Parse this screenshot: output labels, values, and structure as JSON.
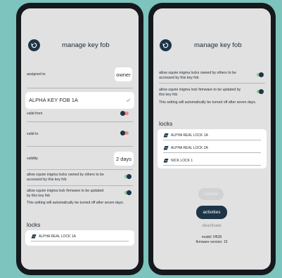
{
  "left": {
    "title": "manage key fob",
    "assigned_label": "assigned to",
    "assigned_value": "owner",
    "fob_name": "ALPHA KEY FOB 1A",
    "valid_from_label": "valid from",
    "valid_to_label": "valid to",
    "validity_label": "validity",
    "validity_value": "2 days",
    "opt1": "allow squire inigma locks owned by others to be accessed by this key fob",
    "opt2": "allow squire inigma lock firmware to be updated by this key fob",
    "note": "This setting will automatically be turned off after seven days.",
    "locks_title": "locks",
    "locks": [
      "ALPHA REAL LOCK 1A"
    ]
  },
  "right": {
    "title": "manage key fob",
    "opt1": "allow squire inigma locks owned by others to be accessed by this key fob",
    "opt2": "allow squire inigma lock firmware to be updated by this key fob",
    "note": "This setting will automatically be turned off after seven days.",
    "locks_title": "locks",
    "locks": [
      "ALPHA REAL LOCK 1A",
      "ALPHA REAL LOCK 2A",
      "NICK LOCK 1"
    ],
    "update_label": "update",
    "activities_label": "activities",
    "deactivate_label": "deactivate",
    "model": "model: FB28",
    "firmware": "firmware version: 15"
  },
  "colors": {
    "background": "#7cc4bd",
    "accent_dark": "#1d3547",
    "toggle_on": "#8fc98f",
    "toggle_off": "#e88e8e"
  }
}
